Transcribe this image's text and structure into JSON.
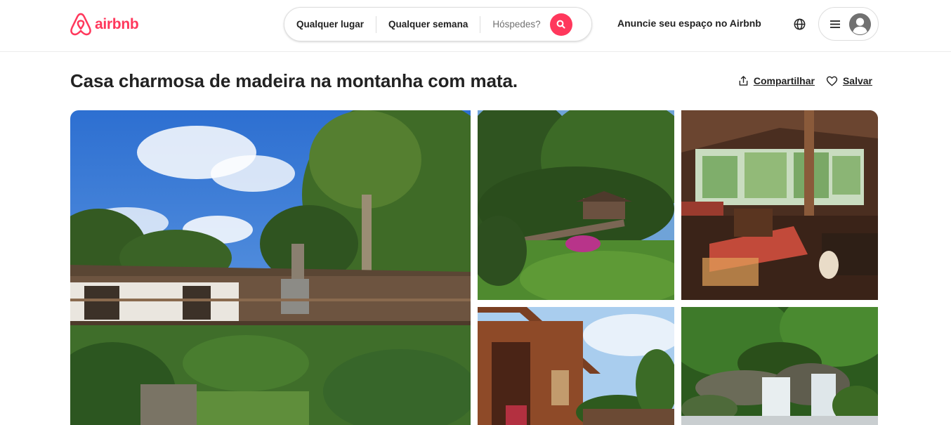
{
  "brand": {
    "name": "airbnb",
    "color": "#FF385C"
  },
  "search": {
    "location_label": "Qualquer lugar",
    "week_label": "Qualquer semana",
    "guests_label": "Hóspedes?",
    "button_icon": "search-icon"
  },
  "header": {
    "host_link": "Anuncie seu espaço no Airbnb",
    "globe_icon": "globe-icon",
    "menu_icon": "hamburger-icon",
    "avatar_icon": "user-avatar-icon"
  },
  "listing": {
    "title": "Casa charmosa de madeira na montanha com mata.",
    "share_label": "Compartilhar",
    "save_label": "Salvar"
  },
  "gallery": {
    "photos": [
      {
        "subject": "wooden house exterior under blue sky"
      },
      {
        "subject": "garden with deck and palm trees"
      },
      {
        "subject": "living room interior with wooden beams"
      },
      {
        "subject": "wooden cabin bedroom exterior"
      },
      {
        "subject": "forest waterfall"
      }
    ]
  }
}
